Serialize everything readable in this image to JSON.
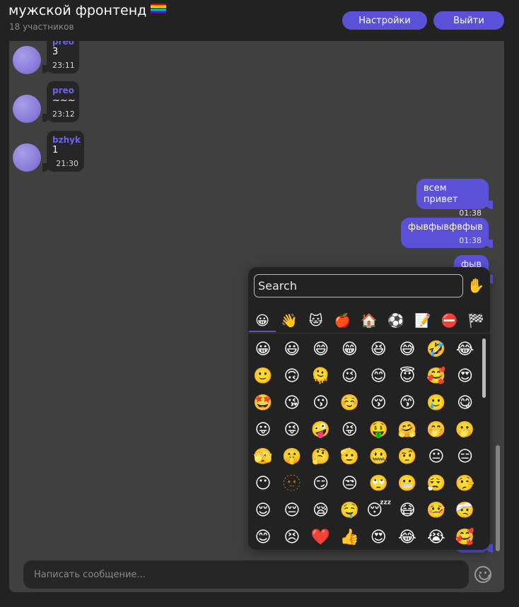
{
  "header": {
    "title": "мужской фронтенд",
    "subtitle": "18 участников",
    "settings_label": "Настройки",
    "logout_label": "Выйти",
    "flag_colors": [
      "#e40303",
      "#ff8c00",
      "#ffed00",
      "#008026",
      "#24b5e0",
      "#004dff",
      "#750787"
    ]
  },
  "messages_in": [
    {
      "user": "preo",
      "text": "3",
      "time": "23:11"
    },
    {
      "user": "preo",
      "text": "~~~",
      "time": "23:12"
    },
    {
      "user": "bzhyk",
      "text": "1",
      "time": "21:30"
    }
  ],
  "messages_out": [
    {
      "text": "всем привет",
      "time": "01:38"
    },
    {
      "text": "фывфывфвфыв",
      "time": "01:38"
    },
    {
      "text": "фыв"
    }
  ],
  "composer": {
    "placeholder": "Написать сообщение..."
  },
  "emoji_picker": {
    "search_placeholder": "Search",
    "skin_tone": "✋",
    "categories": [
      "😀",
      "👋",
      "🐱",
      "🍎",
      "🏠",
      "⚽",
      "📝",
      "⛔",
      "🏁"
    ],
    "active_category": 0,
    "emojis": [
      [
        "😀",
        "😃",
        "😄",
        "😁",
        "😆",
        "😅",
        "🤣",
        "😂"
      ],
      [
        "🙂",
        "🙃",
        "🫠",
        "😉",
        "😊",
        "😇",
        "🥰",
        "😍"
      ],
      [
        "🤩",
        "😘",
        "😗",
        "☺️",
        "😚",
        "😙",
        "🥲",
        "😋"
      ],
      [
        "😛",
        "😜",
        "🤪",
        "😝",
        "🤑",
        "🤗",
        "🤭",
        "🫢"
      ],
      [
        "🫣",
        "🤫",
        "🤔",
        "🫡",
        "🤐",
        "🤨",
        "😐",
        "😑"
      ],
      [
        "😶",
        "🫥",
        "😏",
        "😒",
        "🙄",
        "😬",
        "😮‍💨",
        "🤥"
      ],
      [
        "😌",
        "😔",
        "😪",
        "🤤",
        "😴",
        "😷",
        "🤒",
        "🤕"
      ],
      [
        "😊",
        "😣",
        "❤️",
        "👍",
        "😍",
        "😂",
        "😭",
        "🥰"
      ]
    ]
  }
}
